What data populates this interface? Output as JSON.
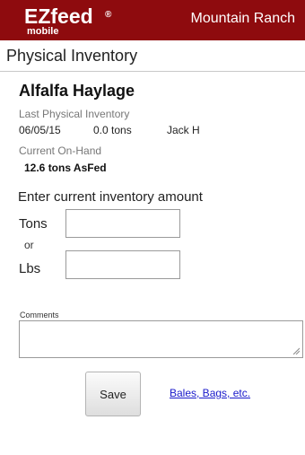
{
  "header": {
    "logo_text": "EZfeed",
    "logo_registered": "®",
    "logo_sub": "mobile",
    "ranch_name": "Mountain Ranch",
    "bar_color": "#8e0b0e"
  },
  "page": {
    "title": "Physical Inventory"
  },
  "product": {
    "name": "Alfalfa Haylage"
  },
  "last_inventory": {
    "label": "Last Physical Inventory",
    "date": "06/05/15",
    "amount": "0.0 tons",
    "user": "Jack H"
  },
  "on_hand": {
    "label": "Current On-Hand",
    "value": "12.6 tons AsFed"
  },
  "entry": {
    "prompt": "Enter current inventory amount",
    "tons_label": "Tons",
    "or_label": "or",
    "lbs_label": "Lbs",
    "tons_value": "",
    "lbs_value": "",
    "comments_label": "Comments",
    "comments_value": ""
  },
  "actions": {
    "save_label": "Save",
    "bales_link": "Bales, Bags, etc.",
    "link_color": "#1a1acb"
  }
}
